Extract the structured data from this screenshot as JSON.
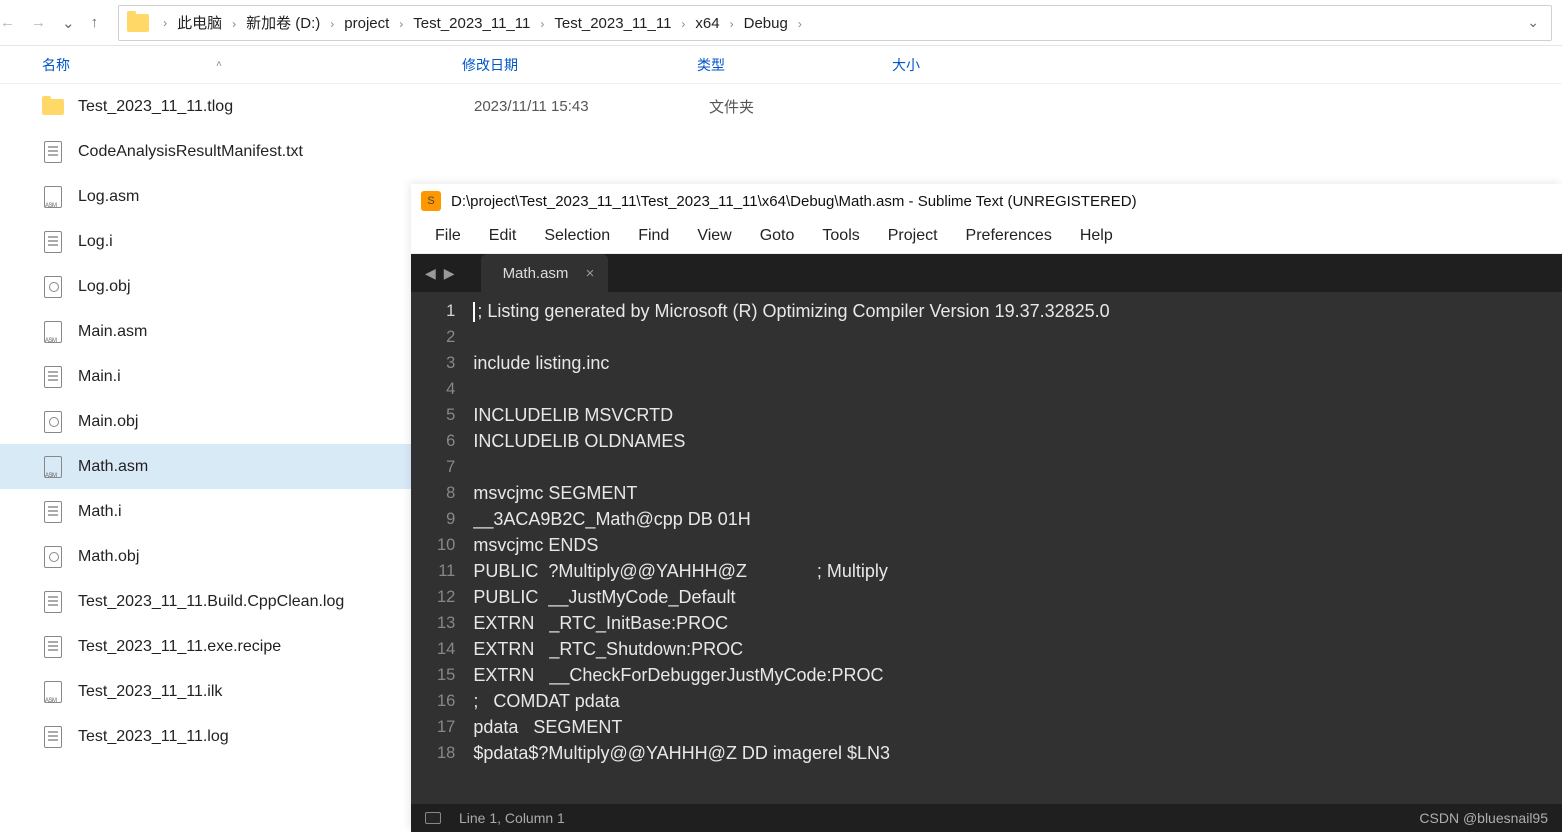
{
  "breadcrumb": [
    "此电脑",
    "新加卷 (D:)",
    "project",
    "Test_2023_11_11",
    "Test_2023_11_11",
    "x64",
    "Debug"
  ],
  "columns": {
    "name": "名称",
    "date": "修改日期",
    "type": "类型",
    "size": "大小"
  },
  "files": [
    {
      "icon": "folder",
      "name": "Test_2023_11_11.tlog",
      "date": "2023/11/11 15:43",
      "type": "文件夹",
      "sel": false
    },
    {
      "icon": "doc",
      "name": "CodeAnalysisResultManifest.txt",
      "sel": false
    },
    {
      "icon": "asm",
      "name": "Log.asm",
      "sel": false
    },
    {
      "icon": "doc",
      "name": "Log.i",
      "sel": false
    },
    {
      "icon": "obj",
      "name": "Log.obj",
      "sel": false
    },
    {
      "icon": "asm",
      "name": "Main.asm",
      "sel": false
    },
    {
      "icon": "doc",
      "name": "Main.i",
      "sel": false
    },
    {
      "icon": "obj",
      "name": "Main.obj",
      "sel": false
    },
    {
      "icon": "asm",
      "name": "Math.asm",
      "sel": true
    },
    {
      "icon": "doc",
      "name": "Math.i",
      "sel": false
    },
    {
      "icon": "obj",
      "name": "Math.obj",
      "sel": false
    },
    {
      "icon": "doc",
      "name": "Test_2023_11_11.Build.CppClean.log",
      "sel": false
    },
    {
      "icon": "doc",
      "name": "Test_2023_11_11.exe.recipe",
      "sel": false
    },
    {
      "icon": "asm",
      "name": "Test_2023_11_11.ilk",
      "sel": false
    },
    {
      "icon": "doc",
      "name": "Test_2023_11_11.log",
      "sel": false
    }
  ],
  "sublime": {
    "title": "D:\\project\\Test_2023_11_11\\Test_2023_11_11\\x64\\Debug\\Math.asm - Sublime Text (UNREGISTERED)",
    "menu": [
      "File",
      "Edit",
      "Selection",
      "Find",
      "View",
      "Goto",
      "Tools",
      "Project",
      "Preferences",
      "Help"
    ],
    "tab": "Math.asm",
    "lines": [
      "; Listing generated by Microsoft (R) Optimizing Compiler Version 19.37.32825.0",
      "",
      "include listing.inc",
      "",
      "INCLUDELIB MSVCRTD",
      "INCLUDELIB OLDNAMES",
      "",
      "msvcjmc SEGMENT",
      "__3ACA9B2C_Math@cpp DB 01H",
      "msvcjmc ENDS",
      "PUBLIC  ?Multiply@@YAHHH@Z              ; Multiply",
      "PUBLIC  __JustMyCode_Default",
      "EXTRN   _RTC_InitBase:PROC",
      "EXTRN   _RTC_Shutdown:PROC",
      "EXTRN   __CheckForDebuggerJustMyCode:PROC",
      ";   COMDAT pdata",
      "pdata   SEGMENT",
      "$pdata$?Multiply@@YAHHH@Z DD imagerel $LN3"
    ],
    "status": "Line 1, Column 1"
  },
  "watermark": "CSDN @bluesnail95"
}
